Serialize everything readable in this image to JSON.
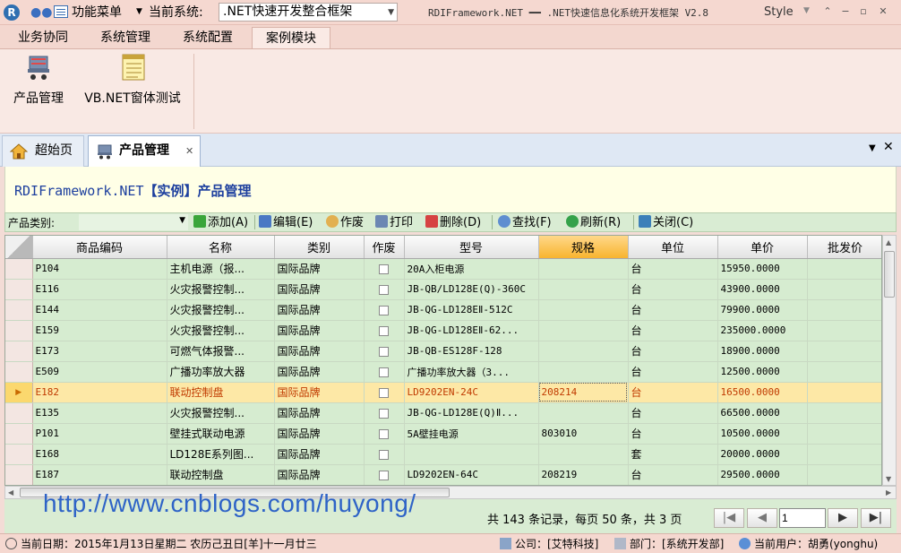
{
  "titlebar": {
    "logo": "R",
    "func_menu": "功能菜单",
    "current_system_label": "当前系统:",
    "current_system": ".NET快速开发整合框架",
    "window_title": "RDIFramework.NET ━━ .NET快速信息化系统开发框架 V2.8",
    "style_label": "Style"
  },
  "ribbon": {
    "tabs": [
      {
        "label": "业务协同"
      },
      {
        "label": "系统管理"
      },
      {
        "label": "系统配置"
      },
      {
        "label": "案例模块"
      }
    ],
    "buttons": [
      {
        "label": "产品管理",
        "icon": "cart-icon"
      },
      {
        "label": "VB.NET窗体测试",
        "icon": "notepad-icon"
      }
    ]
  },
  "doc_tabs": [
    {
      "label": "超始页",
      "icon": "home-icon"
    },
    {
      "label": "产品管理",
      "icon": "cart-icon"
    }
  ],
  "page": {
    "heading_en": "RDIFramework.NET",
    "heading_cn": "【实例】产品管理"
  },
  "toolbar": {
    "category_label": "产品类别:",
    "add": "添加(A)",
    "edit": "编辑(E)",
    "void": "作废",
    "print": "打印",
    "delete": "删除(D)",
    "find": "查找(F)",
    "refresh": "刷新(R)",
    "close": "关闭(C)"
  },
  "grid": {
    "columns": [
      "商品编码",
      "名称",
      "类别",
      "作废",
      "型号",
      "规格",
      "单位",
      "单价",
      "批发价"
    ],
    "rows": [
      {
        "code": "P104",
        "name": "主机电源（报...",
        "category": "国际品牌",
        "model": "20A入柜电源",
        "spec": "",
        "unit": "台",
        "price": "15950.0000",
        "wholesale": ""
      },
      {
        "code": "E116",
        "name": "火灾报警控制...",
        "category": "国际品牌",
        "model": "JB-QB/LD128E(Q)-360C",
        "spec": "",
        "unit": "台",
        "price": "43900.0000",
        "wholesale": ""
      },
      {
        "code": "E144",
        "name": "火灾报警控制...",
        "category": "国际品牌",
        "model": "JB-QG-LD128EⅡ-512C",
        "spec": "",
        "unit": "台",
        "price": "79900.0000",
        "wholesale": ""
      },
      {
        "code": "E159",
        "name": "火灾报警控制...",
        "category": "国际品牌",
        "model": "JB-QG-LD128EⅡ-62...",
        "spec": "",
        "unit": "台",
        "price": "235000.0000",
        "wholesale": ""
      },
      {
        "code": "E173",
        "name": "可燃气体报警...",
        "category": "国际品牌",
        "model": "JB-QB-ES128F-128",
        "spec": "",
        "unit": "台",
        "price": "18900.0000",
        "wholesale": ""
      },
      {
        "code": "E509",
        "name": "广播功率放大器",
        "category": "国际品牌",
        "model": "广播功率放大器（3...",
        "spec": "",
        "unit": "台",
        "price": "12500.0000",
        "wholesale": ""
      },
      {
        "code": "E182",
        "name": "联动控制盘",
        "category": "国际品牌",
        "model": "LD9202EN-24C",
        "spec": "208214",
        "unit": "台",
        "price": "16500.0000",
        "wholesale": ""
      },
      {
        "code": "E135",
        "name": "火灾报警控制...",
        "category": "国际品牌",
        "model": "JB-QG-LD128E(Q)Ⅱ...",
        "spec": "",
        "unit": "台",
        "price": "66500.0000",
        "wholesale": ""
      },
      {
        "code": "P101",
        "name": "壁挂式联动电源",
        "category": "国际品牌",
        "model": "5A壁挂电源",
        "spec": "803010",
        "unit": "台",
        "price": "10500.0000",
        "wholesale": ""
      },
      {
        "code": "E168",
        "name": "LD128E系列图...",
        "category": "国际品牌",
        "model": "",
        "spec": "",
        "unit": "套",
        "price": "20000.0000",
        "wholesale": ""
      },
      {
        "code": "E187",
        "name": "联动控制盘",
        "category": "国际品牌",
        "model": "LD9202EN-64C",
        "spec": "208219",
        "unit": "台",
        "price": "29500.0000",
        "wholesale": ""
      }
    ]
  },
  "watermark": "http://www.cnblogs.com/huyong/",
  "pager": {
    "summary": "共 143 条记录，每页 50 条，共 3 页",
    "current_page": "1"
  },
  "statusbar": {
    "date": "当前日期：2015年1月13日星期二 农历己丑日[羊]十一月廿三",
    "company": "公司：[艾特科技]",
    "department": "部门：[系统开发部]",
    "user": "当前用户：胡勇(yonghu)"
  }
}
